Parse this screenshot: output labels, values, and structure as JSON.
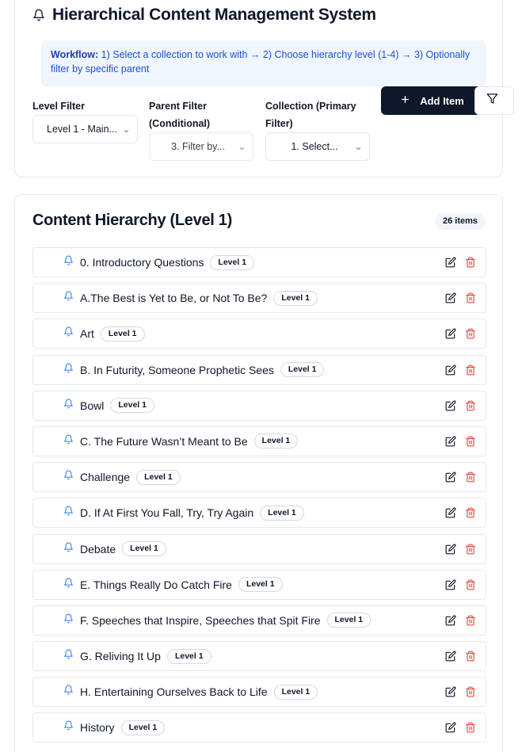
{
  "header": {
    "title": "Hierarchical Content Management System",
    "icon": "bell-icon"
  },
  "workflow": {
    "label": "Workflow:",
    "text": " 1) Select a collection to work with → 2) Choose hierarchy level (1-4) → 3) Optionally filter by specific parent"
  },
  "filters": {
    "level": {
      "label": "Level Filter",
      "value": "Level 1 - Main..."
    },
    "parent": {
      "label": "Parent Filter (Conditional)",
      "value": "3. Filter by..."
    },
    "collection": {
      "label": "Collection (Primary Filter)",
      "value": "1. Select..."
    },
    "add_label": "Add Item"
  },
  "list": {
    "title": "Content Hierarchy (Level 1)",
    "count": "26 items",
    "level_badge": "Level 1",
    "items": [
      "0. Introductory Questions",
      "A.The Best is Yet to Be, or Not To Be?",
      "Art",
      "B. In Futurity, Someone Prophetic Sees",
      "Bowl",
      "C. The Future Wasn’t Meant to Be",
      "Challenge",
      "D. If At First You Fall, Try, Try Again",
      "Debate",
      "E. Things Really Do Catch Fire",
      "F. Speeches that Inspire, Speeches that Spit Fire",
      "G. Reliving It Up",
      "H. Entertaining Ourselves Back to Life",
      "History"
    ]
  },
  "colors": {
    "accent_blue": "#3b82f6",
    "danger_red": "#ef4444",
    "primary_dark": "#0f172a"
  }
}
